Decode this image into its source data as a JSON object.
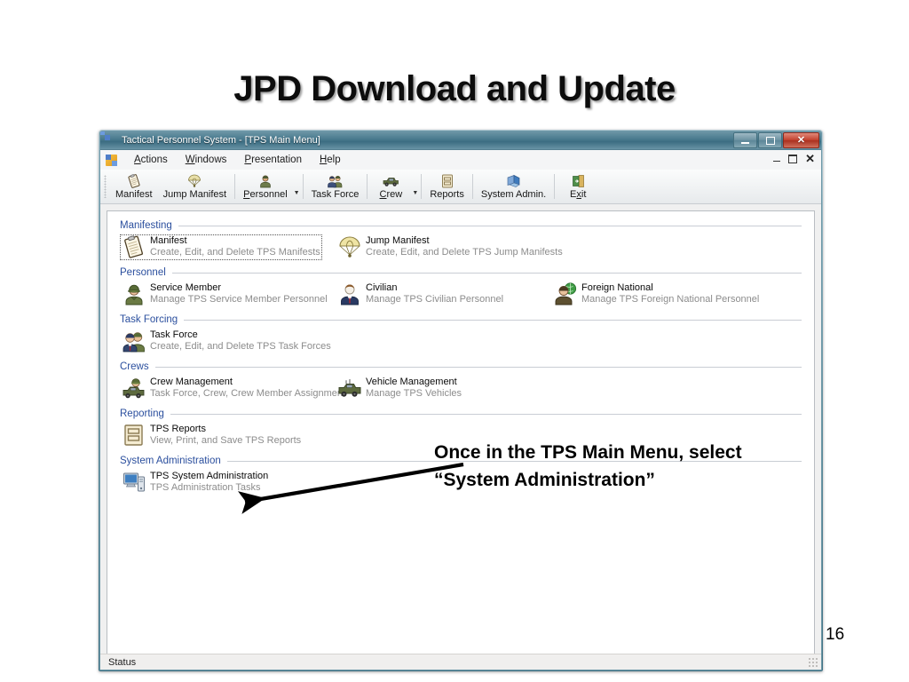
{
  "slide": {
    "title": "JPD Download and Update",
    "page_number": "16"
  },
  "annotation": {
    "line1": "Once in the TPS Main Menu, select",
    "line2": "“System Administration”"
  },
  "window": {
    "title": "Tactical Personnel System - [TPS Main Menu]",
    "title_icon": "visual-basic-app-icon",
    "controls": {
      "minimize": "–",
      "maximize": "□",
      "close": "✕"
    },
    "mdi_controls": {
      "minimize": "–",
      "restore": "❐",
      "close": "✕"
    },
    "status": "Status"
  },
  "menubar": {
    "icon": "visual-basic-app-icon",
    "items": [
      {
        "label": "Actions",
        "accel": "A"
      },
      {
        "label": "Windows",
        "accel": "W"
      },
      {
        "label": "Presentation",
        "accel": "P"
      },
      {
        "label": "Help",
        "accel": "H"
      }
    ]
  },
  "toolbar": {
    "items": [
      {
        "label": "Manifest",
        "accel": "",
        "icon": "clipboard-icon",
        "dropdown": false
      },
      {
        "label": "Jump Manifest",
        "accel": "",
        "icon": "parachute-icon",
        "dropdown": false
      },
      {
        "label": "Personnel",
        "accel": "P",
        "icon": "person-icon",
        "dropdown": true
      },
      {
        "label": "Task Force",
        "accel": "",
        "icon": "two-people-icon",
        "dropdown": false
      },
      {
        "label": "Crew",
        "accel": "C",
        "icon": "vehicle-icon",
        "dropdown": true
      },
      {
        "label": "Reports",
        "accel": "",
        "icon": "report-document-icon",
        "dropdown": false
      },
      {
        "label": "System Admin.",
        "accel": "",
        "icon": "system-admin-icon",
        "dropdown": false
      },
      {
        "label": "Exit",
        "accel": "x",
        "icon": "exit-door-icon",
        "dropdown": false
      }
    ]
  },
  "main_menu": {
    "sections": [
      {
        "header": "Manifesting",
        "items": [
          {
            "title": "Manifest",
            "desc": "Create, Edit, and Delete TPS Manifests",
            "icon": "clipboard-icon",
            "focused": true
          },
          {
            "title": "Jump Manifest",
            "desc": "Create, Edit, and Delete TPS Jump Manifests",
            "icon": "parachute-icon",
            "focused": false
          }
        ]
      },
      {
        "header": "Personnel",
        "items": [
          {
            "title": "Service Member",
            "desc": "Manage TPS Service Member Personnel",
            "icon": "soldier-icon",
            "focused": false
          },
          {
            "title": "Civilian",
            "desc": "Manage TPS Civilian Personnel",
            "icon": "civilian-icon",
            "focused": false
          },
          {
            "title": "Foreign National",
            "desc": "Manage TPS Foreign National Personnel",
            "icon": "foreign-national-icon",
            "focused": false
          }
        ]
      },
      {
        "header": "Task Forcing",
        "items": [
          {
            "title": "Task Force",
            "desc": "Create, Edit, and Delete TPS Task Forces",
            "icon": "two-people-icon",
            "focused": false
          }
        ]
      },
      {
        "header": "Crews",
        "items": [
          {
            "title": "Crew Management",
            "desc": "Task Force, Crew, Crew Member Assignment",
            "icon": "crew-vehicle-icon",
            "focused": false
          },
          {
            "title": "Vehicle Management",
            "desc": "Manage TPS Vehicles",
            "icon": "vehicle-icon",
            "focused": false
          }
        ]
      },
      {
        "header": "Reporting",
        "items": [
          {
            "title": "TPS Reports",
            "desc": "View, Print, and Save TPS Reports",
            "icon": "report-document-icon",
            "focused": false
          }
        ]
      },
      {
        "header": "System Administration",
        "items": [
          {
            "title": "TPS System Administration",
            "desc": "TPS Administration Tasks",
            "icon": "computer-icon",
            "focused": false
          }
        ]
      }
    ]
  },
  "colors": {
    "section_header": "#2b4f9e",
    "window_frame": "#3f7184",
    "title_bar": "#4c7c90",
    "close_button": "#c4422f",
    "desc_text": "#8c8c8c"
  }
}
